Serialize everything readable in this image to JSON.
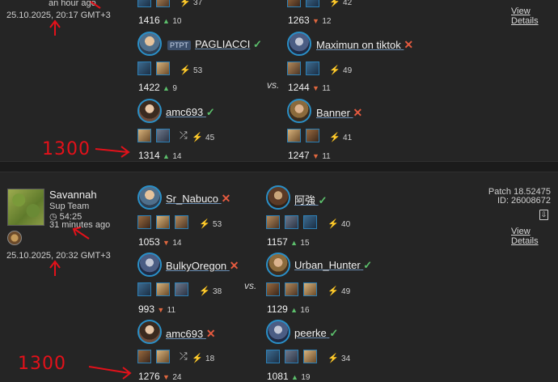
{
  "match1": {
    "time_ago": "an hour ago",
    "datetime": "25.10.2025, 20:17 GMT+3",
    "view_details": "View Details",
    "vs": "vs.",
    "annotation": "1300",
    "team_left": [
      {
        "name": "",
        "rating": "1416",
        "delta": "10",
        "dir": "up",
        "bolt": "37"
      },
      {
        "name": "PAGLIACCI",
        "tag": "PTPT",
        "result": "win",
        "rating": "1422",
        "delta": "9",
        "dir": "up",
        "bolt": "53"
      },
      {
        "name": "amc693",
        "result": "win",
        "rating": "1314",
        "delta": "14",
        "dir": "up",
        "bolt": "45"
      }
    ],
    "team_right": [
      {
        "name": "",
        "rating": "1263",
        "delta": "12",
        "dir": "down",
        "bolt": "42"
      },
      {
        "name": "Maximun on tiktok",
        "result": "loss",
        "rating": "1244",
        "delta": "11",
        "dir": "down",
        "bolt": "49"
      },
      {
        "name": "Banner",
        "result": "loss",
        "rating": "1247",
        "delta": "11",
        "dir": "down",
        "bolt": "41"
      }
    ]
  },
  "match2": {
    "map_name": "Savannah",
    "mode": "Sup Team",
    "duration": "54:25",
    "time_ago": "31 minutes ago",
    "datetime": "25.10.2025, 20:32 GMT+3",
    "patch": "Patch 18.52475",
    "id": "ID: 26008672",
    "view_details": "View Details",
    "vs": "vs.",
    "annotation": "1300",
    "team_left": [
      {
        "name": "Sr_Nabuco",
        "result": "loss",
        "rating": "1053",
        "delta": "14",
        "dir": "down",
        "bolt": "53"
      },
      {
        "name": "BulkyOregon",
        "result": "loss",
        "rating": "993",
        "delta": "11",
        "dir": "down",
        "bolt": "38"
      },
      {
        "name": "amc693",
        "result": "loss",
        "rating": "1276",
        "delta": "24",
        "dir": "down",
        "bolt": "18"
      }
    ],
    "team_right": [
      {
        "name": "阿強",
        "result": "win",
        "rating": "1157",
        "delta": "15",
        "dir": "up",
        "bolt": "40"
      },
      {
        "name": "Urban_Hunter",
        "result": "win",
        "rating": "1129",
        "delta": "16",
        "dir": "up",
        "bolt": "49"
      },
      {
        "name": "peerke",
        "result": "win",
        "rating": "1081",
        "delta": "19",
        "dir": "up",
        "bolt": "34"
      }
    ]
  },
  "icons": {
    "check": "✓",
    "cross": "✕",
    "bolt": "⚡",
    "up": "▲",
    "down": "▼",
    "random": "⤮",
    "clock": "◷",
    "download": "⇩"
  }
}
